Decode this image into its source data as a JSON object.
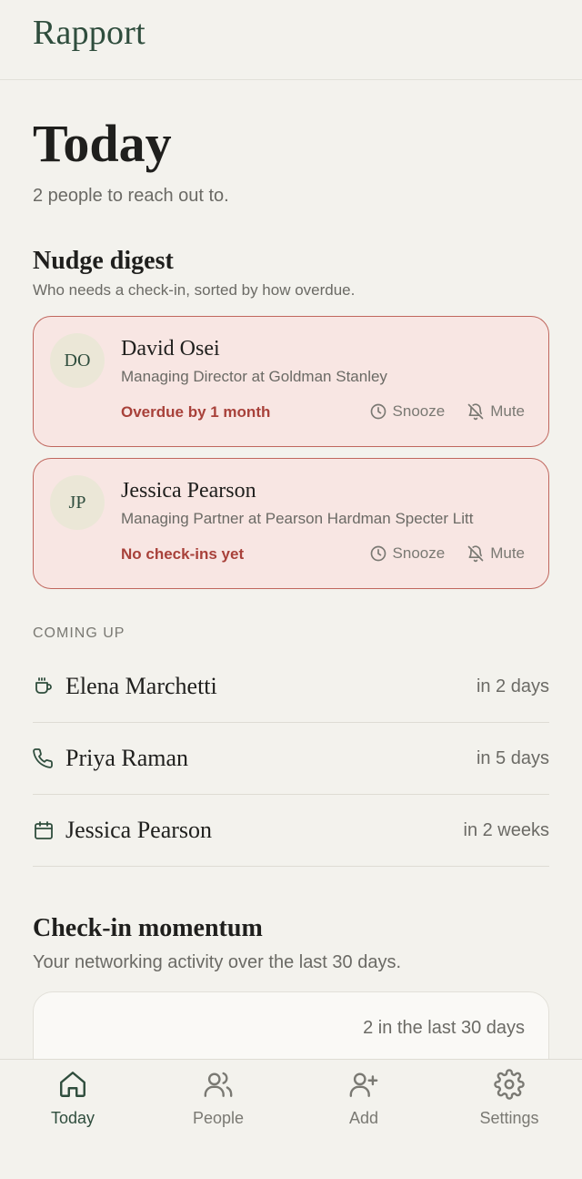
{
  "app": {
    "brand": "Rapport"
  },
  "page": {
    "title": "Today",
    "subtitle": "2 people to reach out to."
  },
  "nudge_digest": {
    "title": "Nudge digest",
    "subtitle": "Who needs a check-in, sorted by how overdue.",
    "snooze_label": "Snooze",
    "mute_label": "Mute",
    "items": [
      {
        "initials": "DO",
        "name": "David Osei",
        "role": "Managing Director at Goldman Stanley",
        "status": "Overdue by 1 month"
      },
      {
        "initials": "JP",
        "name": "Jessica Pearson",
        "role": "Managing Partner at Pearson Hardman Specter Litt",
        "status": "No check-ins yet"
      }
    ]
  },
  "coming_up": {
    "label": "COMING UP",
    "items": [
      {
        "icon": "coffee-icon",
        "name": "Elena Marchetti",
        "when": "in 2 days"
      },
      {
        "icon": "phone-icon",
        "name": "Priya Raman",
        "when": "in 5 days"
      },
      {
        "icon": "calendar-icon",
        "name": "Jessica Pearson",
        "when": "in 2 weeks"
      }
    ]
  },
  "momentum": {
    "title": "Check-in momentum",
    "subtitle": "Your networking activity over the last 30 days.",
    "count_text": "2 in the last 30 days"
  },
  "nav": {
    "items": [
      {
        "label": "Today",
        "icon": "home-icon",
        "active": true
      },
      {
        "label": "People",
        "icon": "people-icon",
        "active": false
      },
      {
        "label": "Add",
        "icon": "add-user-icon",
        "active": false
      },
      {
        "label": "Settings",
        "icon": "gear-icon",
        "active": false
      }
    ]
  },
  "colors": {
    "brand": "#2f4d3d",
    "overdue": "#a8413a",
    "card_bg": "#f8e6e3",
    "card_border": "#c0675e"
  }
}
